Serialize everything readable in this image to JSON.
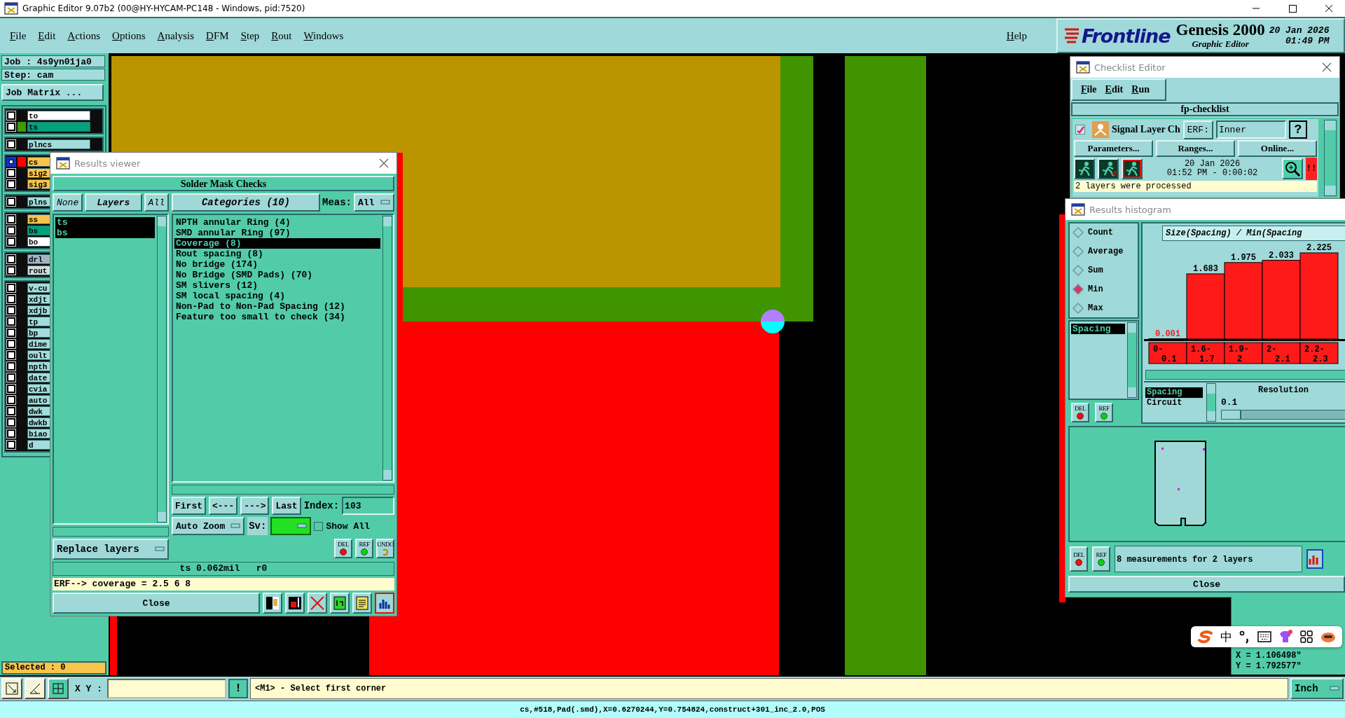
{
  "window": {
    "title": "Graphic Editor 9.07b2 (00@HY-HYCAM-PC148 - Windows, pid:7520)"
  },
  "menu": [
    "File",
    "Edit",
    "Actions",
    "Options",
    "Analysis",
    "DFM",
    "Step",
    "Rout",
    "Windows"
  ],
  "help_menu": "Help",
  "brand": {
    "logo": "Frontline",
    "product": "Genesis 2000",
    "subtitle": "Graphic Editor",
    "date": "20 Jan 2026",
    "time": "01:49 PM"
  },
  "job_panel": {
    "job": "Job : 4s9yn01ja0",
    "step": "Step: cam",
    "matrix_button": "Job Matrix ...",
    "layer_groups": [
      {
        "layers": [
          {
            "name": "to",
            "kind": "silk",
            "work": false
          },
          {
            "name": "ts",
            "kind": "mask",
            "color": "#3c9c00",
            "work": false
          }
        ]
      },
      {
        "layers": [
          {
            "name": "plncs",
            "kind": "misc",
            "work": false
          }
        ]
      },
      {
        "layers": [
          {
            "name": "cs",
            "kind": "signal",
            "color": "#ff0000",
            "work": true
          },
          {
            "name": "sig2",
            "kind": "signal",
            "work": false
          },
          {
            "name": "sig3",
            "kind": "signal",
            "work": false
          }
        ]
      },
      {
        "layers": [
          {
            "name": "plns",
            "kind": "misc",
            "work": false
          }
        ]
      },
      {
        "layers": [
          {
            "name": "ss",
            "kind": "signal",
            "work": false
          },
          {
            "name": "bs",
            "kind": "mask",
            "work": false
          },
          {
            "name": "bo",
            "kind": "silk",
            "work": false
          }
        ]
      },
      {
        "layers": [
          {
            "name": "drl",
            "kind": "drill",
            "work": false
          },
          {
            "name": "rout",
            "kind": "rout",
            "work": false
          }
        ]
      },
      {
        "layers": [
          {
            "name": "v-cu",
            "kind": "misc",
            "work": false
          },
          {
            "name": "xdjt",
            "kind": "misc",
            "work": false
          },
          {
            "name": "xdjb",
            "kind": "misc",
            "work": false
          },
          {
            "name": "tp",
            "kind": "misc",
            "work": false
          },
          {
            "name": "bp",
            "kind": "misc",
            "work": false
          },
          {
            "name": "dime",
            "kind": "misc",
            "work": false
          },
          {
            "name": "oult",
            "kind": "misc",
            "work": false
          },
          {
            "name": "npth",
            "kind": "misc",
            "work": false
          },
          {
            "name": "date",
            "kind": "misc",
            "work": false
          },
          {
            "name": "cvia",
            "kind": "misc",
            "work": false
          },
          {
            "name": "auto",
            "kind": "misc",
            "work": false
          },
          {
            "name": "dwk",
            "kind": "misc",
            "work": false
          },
          {
            "name": "dwkb",
            "kind": "misc",
            "work": false
          },
          {
            "name": "biao",
            "kind": "misc",
            "work": false
          },
          {
            "name": "d",
            "kind": "misc",
            "work": false
          }
        ]
      }
    ],
    "selected": "Selected : 0"
  },
  "results_viewer": {
    "title": "Results viewer",
    "heading": "Solder Mask Checks",
    "layer_buttons": [
      "None",
      "Layers",
      "All"
    ],
    "layers": [
      {
        "name": "ts",
        "selected": true
      },
      {
        "name": "bs",
        "selected": true
      }
    ],
    "replace_mode": "Replace layers",
    "categories_button": "Categories (10)",
    "meas_label": "Meas:",
    "meas_value": "All",
    "categories": [
      {
        "label": "NPTH annular Ring (4)",
        "selected": false
      },
      {
        "label": "SMD annular Ring (97)",
        "selected": false
      },
      {
        "label": "Coverage (8)",
        "selected": true
      },
      {
        "label": "Rout spacing (8)",
        "selected": false
      },
      {
        "label": "No bridge (174)",
        "selected": false
      },
      {
        "label": "No Bridge (SMD Pads) (70)",
        "selected": false
      },
      {
        "label": "SM slivers (12)",
        "selected": false
      },
      {
        "label": "SM local spacing (4)",
        "selected": false
      },
      {
        "label": "Non-Pad to Non-Pad Spacing (12)",
        "selected": false
      },
      {
        "label": "Feature too small to check (34)",
        "selected": false
      }
    ],
    "nav_buttons": [
      "First",
      "<---",
      "--->",
      "Last"
    ],
    "index_label": "Index:",
    "index_value": "103",
    "zoom_mode": "Auto Zoom",
    "sv_label": "Sv:",
    "show_all": {
      "label": "Show All",
      "checked": false
    },
    "action_buttons": [
      {
        "kind": "del",
        "label": "DEL"
      },
      {
        "kind": "ref",
        "label": "REF"
      },
      {
        "kind": "undo",
        "label": "UNDO"
      }
    ],
    "status": "ts 0.062mil   r0",
    "erf_line": "ERF--> coverage = 2.5 6 8",
    "close": "Close",
    "tool_icons": [
      {
        "kind": "layers",
        "active": false
      },
      {
        "kind": "probe",
        "active": false
      },
      {
        "kind": "erf",
        "active": false
      },
      {
        "kind": "page",
        "active": false
      },
      {
        "kind": "notes",
        "active": false
      },
      {
        "kind": "histogram",
        "active": true
      }
    ]
  },
  "checklist_editor": {
    "title": "Checklist Editor",
    "menu": [
      "File",
      "Edit",
      "Run"
    ],
    "name": "fp-checklist",
    "action": {
      "enabled": true,
      "label": "Signal Layer Ch",
      "erf_button": "ERF:",
      "erf_value": "Inner",
      "help": "?"
    },
    "buttons": [
      "Parameters...",
      "Ranges...",
      "Online..."
    ],
    "run_buttons": [
      {
        "kind": "run"
      },
      {
        "kind": "run-lines"
      },
      {
        "kind": "run-stop"
      }
    ],
    "run_date": "20 Jan 2026",
    "run_time": "01:52 PM - 0:00:02",
    "alert": "!!",
    "message": "2 layers were processed"
  },
  "histogram": {
    "title": "Results histogram",
    "modes": [
      {
        "label": "Count",
        "selected": false
      },
      {
        "label": "Average",
        "selected": false
      },
      {
        "label": "Sum",
        "selected": false
      },
      {
        "label": "Min",
        "selected": true
      },
      {
        "label": "Max",
        "selected": false
      }
    ],
    "measures": [
      {
        "label": "Spacing",
        "selected": true
      }
    ],
    "action_buttons": [
      {
        "kind": "del",
        "label": "DEL"
      },
      {
        "kind": "ref",
        "label": "REF"
      }
    ],
    "chart_data": {
      "type": "bar",
      "title": "Size(Spacing) / Min(Spacing",
      "categories": [
        "0-0.1",
        "1.6-1.7",
        "1.9-2",
        "2-2.1",
        "2.2-2.3"
      ],
      "values": [
        0.001,
        1.683,
        1.975,
        2.033,
        2.225
      ],
      "data_labels": true
    },
    "types": [
      {
        "label": "Spacing",
        "selected": true
      },
      {
        "label": "Circuit",
        "selected": false
      }
    ],
    "resolution_label": "Resolution",
    "resolution_value": "0.1",
    "resolution_slider": {
      "level": 0.0
    },
    "summary_buttons": [
      {
        "kind": "del",
        "label": "DEL"
      },
      {
        "kind": "ref",
        "label": "REF"
      }
    ],
    "summary": "8 measurements for 2 layers",
    "close": "Close"
  },
  "readout": {
    "x": "X = 1.106498\"",
    "y": "Y = 1.792577\""
  },
  "ime_toolbar": {
    "mode": "中"
  },
  "bottom_tools": [
    {
      "kind": "zoom-box",
      "active": false
    },
    {
      "kind": "measure",
      "active": false
    },
    {
      "kind": "grid",
      "active": true
    }
  ],
  "coordinate_label": "X Y :",
  "alert_button": "!",
  "prompt": "<M1> - Select first corner",
  "units": "Inch",
  "status_line": "cs,#518,Pad(.smd),X=0.6270244,Y=0.754824,construct+301_inc_2.0,POS"
}
